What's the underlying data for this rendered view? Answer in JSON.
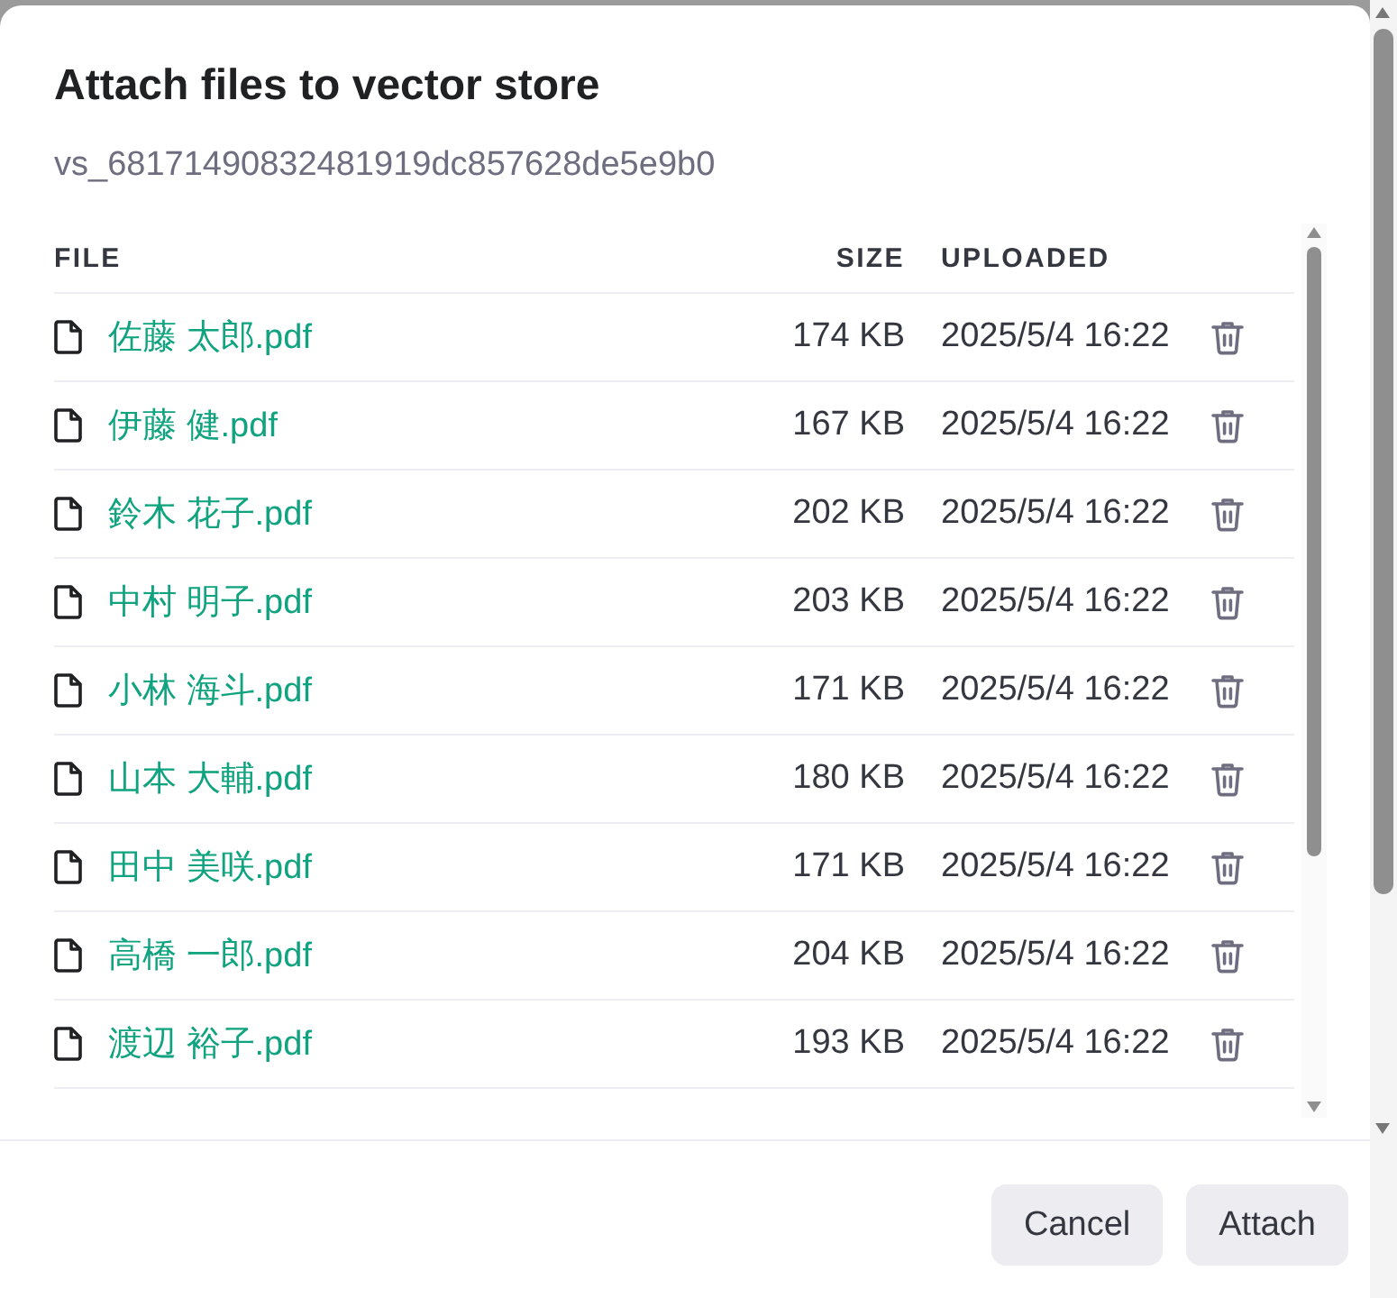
{
  "dialog": {
    "title": "Attach files to vector store",
    "store_id": "vs_68171490832481919dc857628de5e9b0"
  },
  "table": {
    "columns": [
      "FILE",
      "SIZE",
      "UPLOADED"
    ],
    "rows": [
      {
        "name": "佐藤 太郎.pdf",
        "size": "174 KB",
        "uploaded": "2025/5/4 16:22"
      },
      {
        "name": "伊藤 健.pdf",
        "size": "167 KB",
        "uploaded": "2025/5/4 16:22"
      },
      {
        "name": "鈴木 花子.pdf",
        "size": "202 KB",
        "uploaded": "2025/5/4 16:22"
      },
      {
        "name": "中村 明子.pdf",
        "size": "203 KB",
        "uploaded": "2025/5/4 16:22"
      },
      {
        "name": "小林 海斗.pdf",
        "size": "171 KB",
        "uploaded": "2025/5/4 16:22"
      },
      {
        "name": "山本 大輔.pdf",
        "size": "180 KB",
        "uploaded": "2025/5/4 16:22"
      },
      {
        "name": "田中 美咲.pdf",
        "size": "171 KB",
        "uploaded": "2025/5/4 16:22"
      },
      {
        "name": "高橋 一郎.pdf",
        "size": "204 KB",
        "uploaded": "2025/5/4 16:22"
      },
      {
        "name": "渡辺 裕子.pdf",
        "size": "193 KB",
        "uploaded": "2025/5/4 16:22"
      }
    ]
  },
  "buttons": [
    "Cancel",
    "Attach"
  ]
}
